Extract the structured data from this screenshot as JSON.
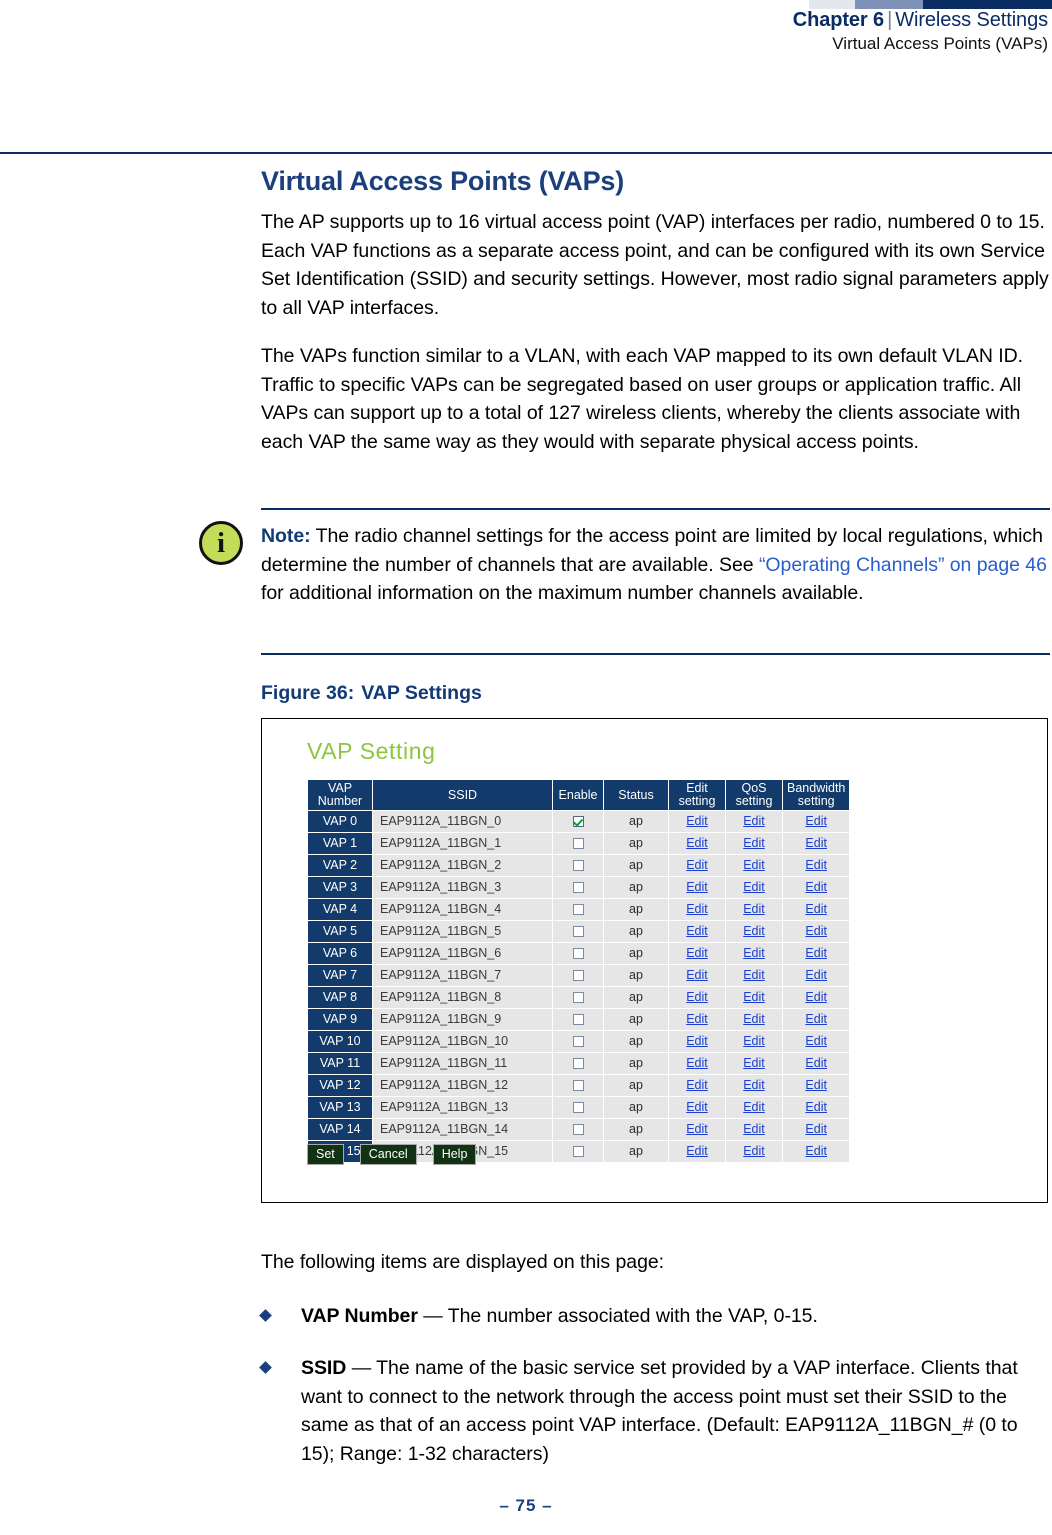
{
  "header": {
    "chapter": "Chapter 6",
    "separator": "|",
    "section": "Wireless Settings",
    "subsection": "Virtual Access Points (VAPs)"
  },
  "page_title": "Virtual Access Points (VAPs)",
  "paragraphs": {
    "p1": "The AP supports up to 16 virtual access point (VAP) interfaces per radio, numbered 0 to 15. Each VAP functions as a separate access point, and can be configured with its own Service Set Identification (SSID) and security settings. However, most radio signal parameters apply to all VAP interfaces.",
    "p2": "The VAPs function similar to a VLAN, with each VAP mapped to its own default VLAN ID. Traffic to specific VAPs can be segregated based on user groups or application traffic. All VAPs can support up to a total of 127 wireless clients, whereby the clients associate with each VAP the same way as they would with separate physical access points.",
    "p3": "The following items are displayed on this page:"
  },
  "note": {
    "icon": "info-icon",
    "label": "Note:",
    "text_before": " The radio channel settings for the access point are limited by local regulations, which determine the number of channels that are available. See ",
    "xref": "“Operating Channels” on page 46",
    "text_after": " for additional information on the maximum number channels available."
  },
  "figure": {
    "caption_number": "Figure 36:",
    "caption_title": "VAP Settings",
    "panel_title": "VAP Setting",
    "columns": [
      "VAP\nNumber",
      "SSID",
      "Enable",
      "Status",
      "Edit\nsetting",
      "QoS\nsetting",
      "Bandwidth\nsetting"
    ],
    "edit_label": "Edit",
    "rows": [
      {
        "vap": "VAP 0",
        "ssid": "EAP9112A_11BGN_0",
        "enable": true,
        "status": "ap"
      },
      {
        "vap": "VAP 1",
        "ssid": "EAP9112A_11BGN_1",
        "enable": false,
        "status": "ap"
      },
      {
        "vap": "VAP 2",
        "ssid": "EAP9112A_11BGN_2",
        "enable": false,
        "status": "ap"
      },
      {
        "vap": "VAP 3",
        "ssid": "EAP9112A_11BGN_3",
        "enable": false,
        "status": "ap"
      },
      {
        "vap": "VAP 4",
        "ssid": "EAP9112A_11BGN_4",
        "enable": false,
        "status": "ap"
      },
      {
        "vap": "VAP 5",
        "ssid": "EAP9112A_11BGN_5",
        "enable": false,
        "status": "ap"
      },
      {
        "vap": "VAP 6",
        "ssid": "EAP9112A_11BGN_6",
        "enable": false,
        "status": "ap"
      },
      {
        "vap": "VAP 7",
        "ssid": "EAP9112A_11BGN_7",
        "enable": false,
        "status": "ap"
      },
      {
        "vap": "VAP 8",
        "ssid": "EAP9112A_11BGN_8",
        "enable": false,
        "status": "ap"
      },
      {
        "vap": "VAP 9",
        "ssid": "EAP9112A_11BGN_9",
        "enable": false,
        "status": "ap"
      },
      {
        "vap": "VAP 10",
        "ssid": "EAP9112A_11BGN_10",
        "enable": false,
        "status": "ap"
      },
      {
        "vap": "VAP 11",
        "ssid": "EAP9112A_11BGN_11",
        "enable": false,
        "status": "ap"
      },
      {
        "vap": "VAP 12",
        "ssid": "EAP9112A_11BGN_12",
        "enable": false,
        "status": "ap"
      },
      {
        "vap": "VAP 13",
        "ssid": "EAP9112A_11BGN_13",
        "enable": false,
        "status": "ap"
      },
      {
        "vap": "VAP 14",
        "ssid": "EAP9112A_11BGN_14",
        "enable": false,
        "status": "ap"
      },
      {
        "vap": "VAP 15",
        "ssid": "EAP9112A_11BGN_15",
        "enable": false,
        "status": "ap"
      }
    ],
    "buttons": [
      "Set",
      "Cancel",
      "Help"
    ]
  },
  "bullets": [
    {
      "term": "VAP Number",
      "dash": " — ",
      "text": "The number associated with the VAP, 0-15."
    },
    {
      "term": "SSID",
      "dash": " — ",
      "text": "The name of the basic service set provided by a VAP interface. Clients that want to connect to the network through the access point must set their SSID to the same as that of an access point VAP interface. (Default: EAP9112A_11BGN_# (0 to 15); Range: 1-32 characters)"
    }
  ],
  "footer": {
    "page_number": "–  75  –"
  },
  "colors": {
    "navy": "#0a2c63",
    "heading_blue": "#1b3f7d",
    "xref_blue": "#2a5fc9",
    "table_header": "#123a6b",
    "panel_title_green": "#8cc63e",
    "button_green": "#123313",
    "note_icon_green": "#c4dd58",
    "link_blue": "#1a3fcf"
  }
}
